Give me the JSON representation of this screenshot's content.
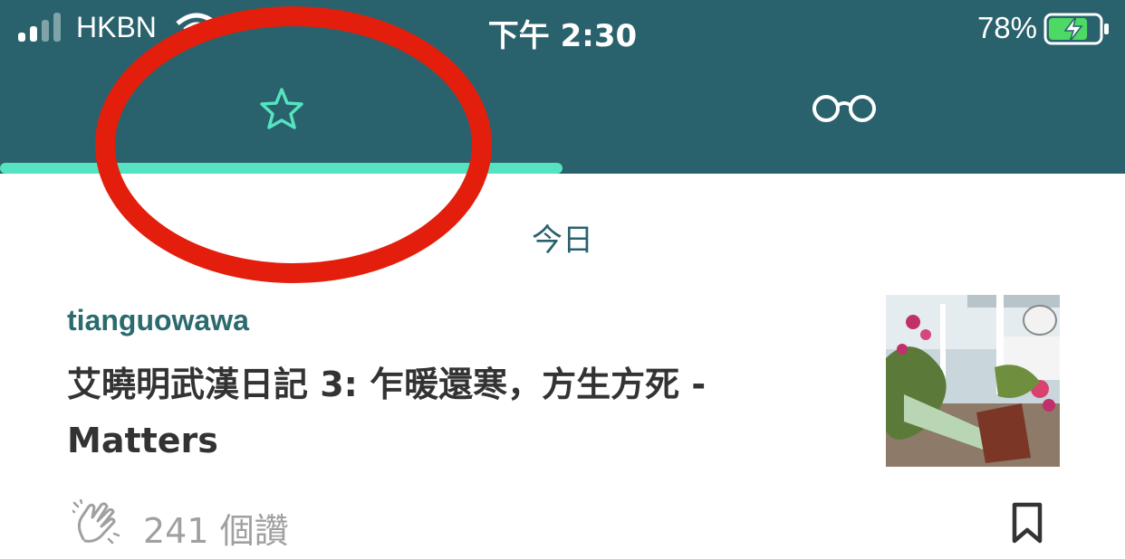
{
  "status_bar": {
    "carrier": "HKBN",
    "time": "下午 2:30",
    "battery_percent": "78%",
    "battery_level": 0.78,
    "signal_bars_filled": 2
  },
  "tabs": [
    {
      "name": "following",
      "icon": "star-icon",
      "selected": true
    },
    {
      "name": "reading",
      "icon": "glasses-icon",
      "selected": false
    }
  ],
  "feed": {
    "section_title": "今日",
    "article": {
      "author": "tianguowawa",
      "title": "艾曉明武漢日記 3: 乍暖還寒，方生方死 - Matters",
      "claps": "241 個讚",
      "thumbnail": "rooftop-garden-photo"
    }
  },
  "colors": {
    "header_bg": "#29626c",
    "accent": "#56e3c1",
    "annotation_circle": "#e31e0c",
    "battery_fill": "#4cd964"
  }
}
